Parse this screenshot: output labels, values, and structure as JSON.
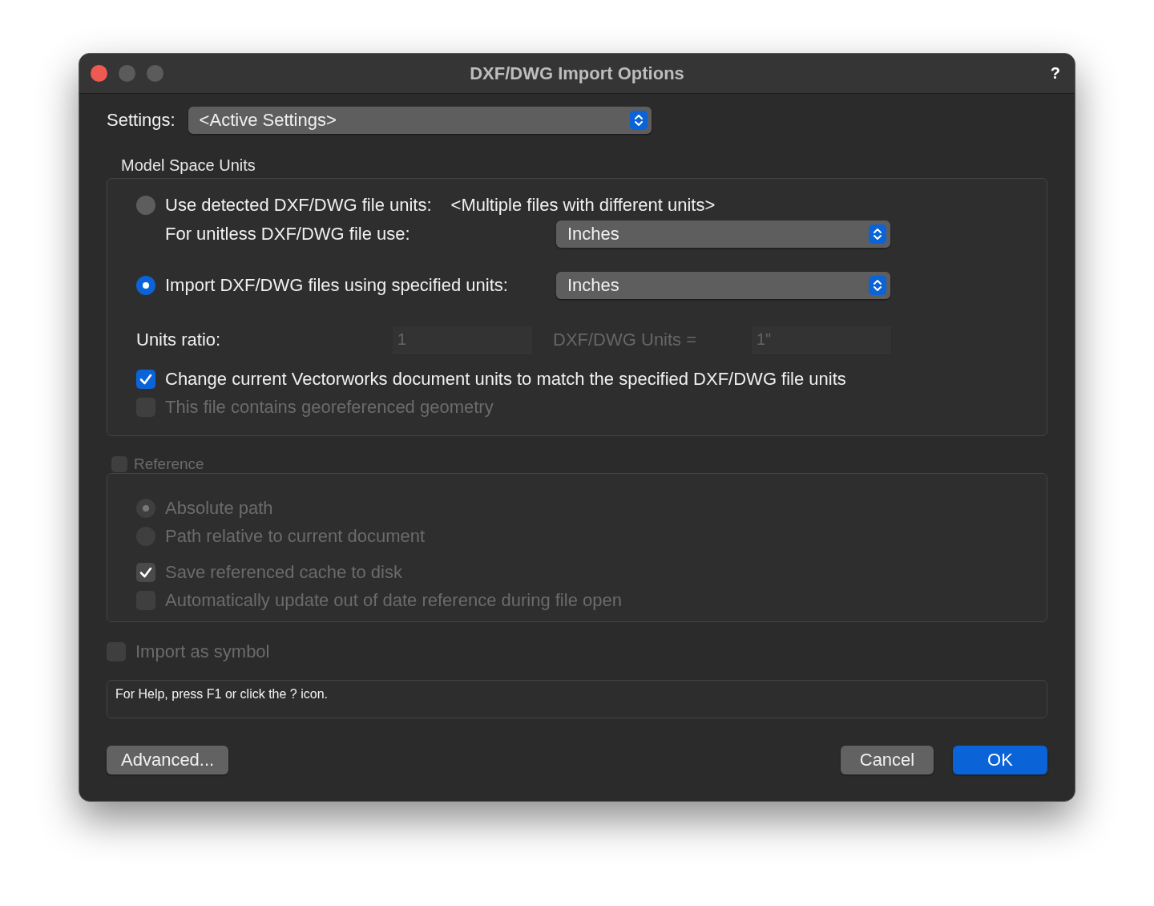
{
  "window": {
    "title": "DXF/DWG Import Options",
    "help": "?"
  },
  "settings": {
    "label": "Settings:",
    "value": "<Active Settings>"
  },
  "model_space": {
    "title": "Model Space Units",
    "detected": {
      "label": "Use detected DXF/DWG file units:",
      "value": "<Multiple files with different units>",
      "selected": false
    },
    "unitless": {
      "label": "For unitless DXF/DWG file use:",
      "value": "Inches"
    },
    "specified": {
      "label": "Import DXF/DWG files using specified units:",
      "value": "Inches",
      "selected": true
    },
    "ratio": {
      "label": "Units ratio:",
      "value": "1",
      "equals": "DXF/DWG Units =",
      "result": "1\"",
      "disabled": true
    },
    "checkboxes": [
      {
        "label": "Change current Vectorworks document units to match the specified DXF/DWG file units",
        "checked": true,
        "disabled": false
      },
      {
        "label": "This file contains georeferenced geometry",
        "checked": false,
        "disabled": true
      }
    ]
  },
  "reference": {
    "label": "Reference",
    "checked": false,
    "disabled": true,
    "radios": [
      {
        "label": "Absolute path",
        "selected": true
      },
      {
        "label": "Path relative to current document",
        "selected": false
      }
    ],
    "checkboxes": [
      {
        "label": "Save referenced cache to disk",
        "checked": true
      },
      {
        "label": "Automatically update out of date reference during file open",
        "checked": false
      }
    ]
  },
  "import_as_symbol": {
    "label": "Import as symbol",
    "checked": false,
    "disabled": true
  },
  "help_text": "For Help, press F1 or click the ? icon.",
  "buttons": [
    {
      "label": "Advanced...",
      "kind": "normal"
    },
    {
      "label": "Cancel",
      "kind": "normal"
    },
    {
      "label": "OK",
      "kind": "default"
    }
  ]
}
